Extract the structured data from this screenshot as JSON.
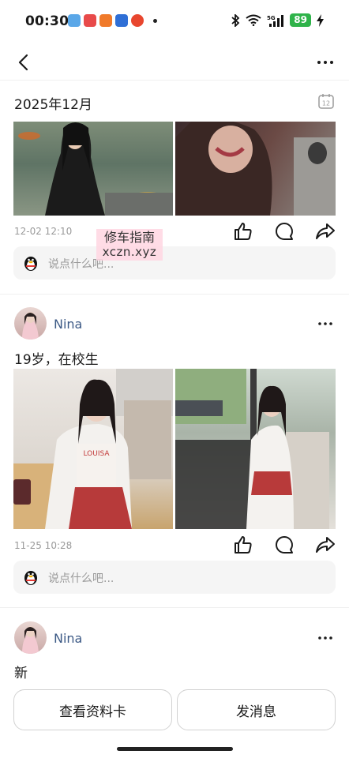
{
  "status_bar": {
    "time": "00:30",
    "battery": "89",
    "network": "5G"
  },
  "nav": {
    "back_icon": "chevron-left-icon",
    "more_icon": "more-dots-icon"
  },
  "date_header": {
    "title": "2025年12月",
    "calendar_day": "12"
  },
  "watermark": {
    "line1": "修车指南",
    "line2": "xczn.xyz"
  },
  "posts": [
    {
      "time": "12-02 12:10",
      "comment_placeholder": "说点什么吧..."
    },
    {
      "user": "Nina",
      "text": "19岁，在校生",
      "time": "11-25 10:28",
      "comment_placeholder": "说点什么吧..."
    },
    {
      "user": "Nina",
      "text": "新"
    }
  ],
  "buttons": {
    "view_card": "查看资料卡",
    "send_message": "发消息"
  },
  "colors": {
    "name_link": "#3d5a86",
    "battery": "#2fb34a",
    "placeholder": "#9a9a9a"
  }
}
